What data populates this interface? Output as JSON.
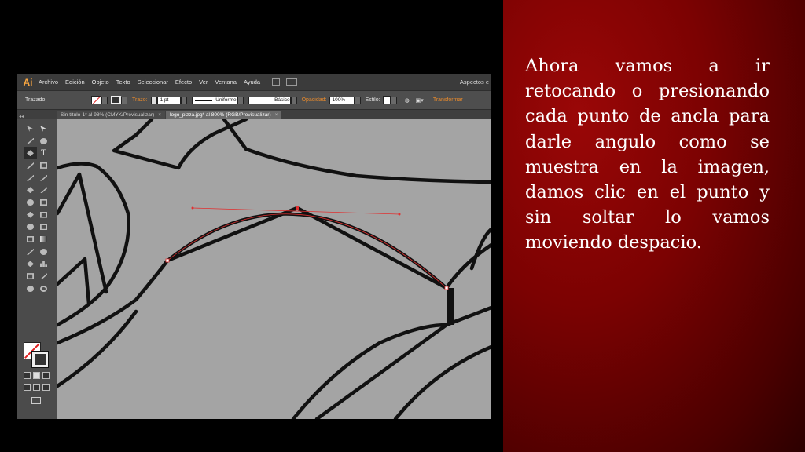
{
  "slide": {
    "text": "Ahora vamos a ir retocando o presionando cada punto de ancla para darle angulo como se muestra en la imagen, damos clic en el punto y sin soltar lo vamos moviendo despacio."
  },
  "app": {
    "logo": "Ai",
    "menu": [
      "Archivo",
      "Edición",
      "Objeto",
      "Texto",
      "Seleccionar",
      "Efecto",
      "Ver",
      "Ventana",
      "Ayuda"
    ],
    "workspace": "Aspectos e"
  },
  "control_bar": {
    "mode_label": "Trazado",
    "stroke_label": "Trazo:",
    "stroke_weight": "1 pt",
    "stroke_profile": "Uniforme",
    "brush": "Básico",
    "opacity_label": "Opacidad:",
    "opacity_value": "100%",
    "style_label": "Estilo:",
    "transform_label": "Transformar"
  },
  "tabs": [
    {
      "label": "Sin título-1* al 98% (CMYK/Previsualizar)",
      "close": "×"
    },
    {
      "label": "logo_pizza.jpg* al 800% (RGB/Previsualizar)",
      "close": "×"
    }
  ],
  "tools": [
    "selection-tool",
    "direct-selection-tool",
    "magic-wand-tool",
    "lasso-tool",
    "pen-tool",
    "type-tool",
    "line-segment-tool",
    "rectangle-tool",
    "paintbrush-tool",
    "pencil-tool",
    "blob-brush-tool",
    "eraser-tool",
    "rotate-tool",
    "scale-tool",
    "width-tool",
    "free-transform-tool",
    "shape-builder-tool",
    "perspective-grid-tool",
    "mesh-tool",
    "gradient-tool",
    "eyedropper-tool",
    "blend-tool",
    "symbol-sprayer-tool",
    "column-graph-tool",
    "artboard-tool",
    "slice-tool",
    "hand-tool",
    "zoom-tool"
  ],
  "colors": {
    "background": "#000000",
    "slide_red": "#8b0000",
    "canvas_gray": "#a4a4a4",
    "path_red": "#e03030",
    "accent_orange": "#e88a2c"
  }
}
